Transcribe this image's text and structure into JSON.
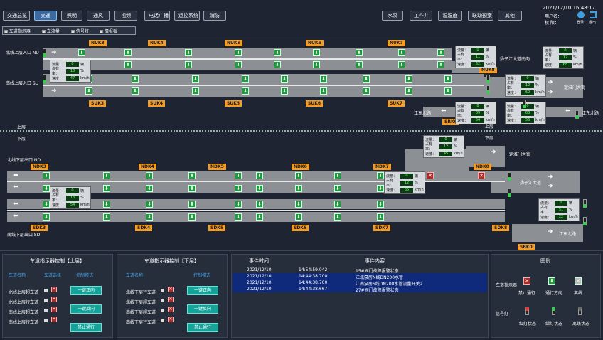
{
  "nav_left": [
    "交通总览",
    "交通",
    "照明",
    "通风",
    "视频",
    "电话广播",
    "运控系统",
    "消防"
  ],
  "nav_right": [
    "水泵",
    "工作井",
    "温湿度",
    "联动预案",
    "其他"
  ],
  "datetime": "2021/12/10 16:48:17",
  "user_label": "用户名：",
  "role_label": "权 限：",
  "login": "登录",
  "logout": "退出",
  "legend_checks": [
    "车道指示器",
    "车流量",
    "信号灯",
    "情报板"
  ],
  "upper": {
    "entry_nu": "北线上层入口 NU",
    "entry_su": "南线上层入口 SU",
    "tags_top": [
      "NUK3",
      "NUK4",
      "NUK5",
      "NUK6",
      "NUK7"
    ],
    "tags_bottom": [
      "SUK3",
      "SUK4",
      "SUK5",
      "SUK6",
      "SUK7"
    ],
    "nuk8": "NUK8",
    "srk0": "SRK0",
    "yangzi": "扬子江大道南向",
    "dinghuai": "定淮门大街",
    "jiangdong_n": "江东北路",
    "jiangdong_r": "江东北路",
    "shang1": "上层",
    "shang2": "上层"
  },
  "lower": {
    "xia1": "下层",
    "xia2": "下层",
    "exit_nd": "北线下层出口 ND",
    "exit_sd": "南线下层出口 SD",
    "tags_top": [
      "NDK3",
      "NDK4",
      "NDK5",
      "NDK6",
      "NDK7",
      "NDK0"
    ],
    "tags_bottom": [
      "SDK3",
      "SDK4",
      "SDK5",
      "SDK6",
      "SDK7",
      "SDK8",
      "SBK0"
    ],
    "dinghuai": "定淮门大街",
    "yangzi": "扬子江大道",
    "jiangdong": "江东北路"
  },
  "stats": [
    {
      "flow": "0",
      "occ": "11",
      "speed": "62"
    },
    {
      "flow": "0",
      "occ": "12",
      "speed": "68"
    },
    {
      "flow": "0",
      "occ": "13",
      "speed": "47"
    },
    {
      "flow": "0",
      "occ": "12",
      "speed": "60"
    },
    {
      "flow": "0",
      "occ": "09",
      "speed": "54"
    },
    {
      "flow": "0",
      "occ": "08",
      "speed": "56"
    },
    {
      "flow": "0",
      "occ": "12",
      "speed": "45"
    },
    {
      "flow": "0",
      "occ": "12",
      "speed": "65"
    },
    {
      "flow": "0",
      "occ": "13",
      "speed": "54"
    },
    {
      "flow": "0",
      "occ": "51",
      "speed": "22"
    }
  ],
  "stat_labels": {
    "flow": "流量：",
    "occ": "占有率：",
    "speed": "速度：",
    "u_flow": "辆",
    "u_occ": "%",
    "u_speed": "km/h"
  },
  "panel1": {
    "title": "车道指示器控制【上层】",
    "col1": "车道名称",
    "col2": "车道选择",
    "col3": "控制模式",
    "lanes": [
      "北线上层超车道",
      "北线上层行车道",
      "南线上层超车道",
      "南线上层行车道"
    ],
    "buttons": [
      "一键正向",
      "一键反向",
      "禁止通行"
    ]
  },
  "panel2": {
    "title": "车道指示器控制【下层】",
    "col1": "车道名称",
    "col3": "控制模式",
    "lanes": [
      "北线下层行车道",
      "北线下层超车道",
      "南线下层超车道",
      "南线下层行车道"
    ],
    "buttons": [
      "一键正向",
      "一键反向",
      "禁止通行"
    ]
  },
  "events": {
    "h_time": "事件时间",
    "h_content": "事件内容",
    "rows": [
      {
        "date": "2021/12/10",
        "time": "14:54:59.042",
        "text": "15#阀门故障报警状态"
      },
      {
        "date": "2021/12/10",
        "time": "14:44:38.700",
        "text": "江北泵房N线DN200水管"
      },
      {
        "date": "2021/12/10",
        "time": "14:44:38.700",
        "text": "江南泵房S线DN200水管流量开关2"
      },
      {
        "date": "2021/12/10",
        "time": "14:44:38.667",
        "text": "27#阀门故障报警状态"
      }
    ]
  },
  "legend": {
    "title": "图例",
    "lane_ind": "车道指示器",
    "forbid": "禁止通行",
    "pass": "通行方向",
    "offline": "离线",
    "signal": "信号灯",
    "red": "红灯状态",
    "green": "绿灯状态",
    "off": "离线状态"
  },
  "colors": {
    "accent": "#3b6aa0",
    "signal_green": "#1f9a3c",
    "signal_red": "#b02828",
    "tag": "#f39c27"
  }
}
